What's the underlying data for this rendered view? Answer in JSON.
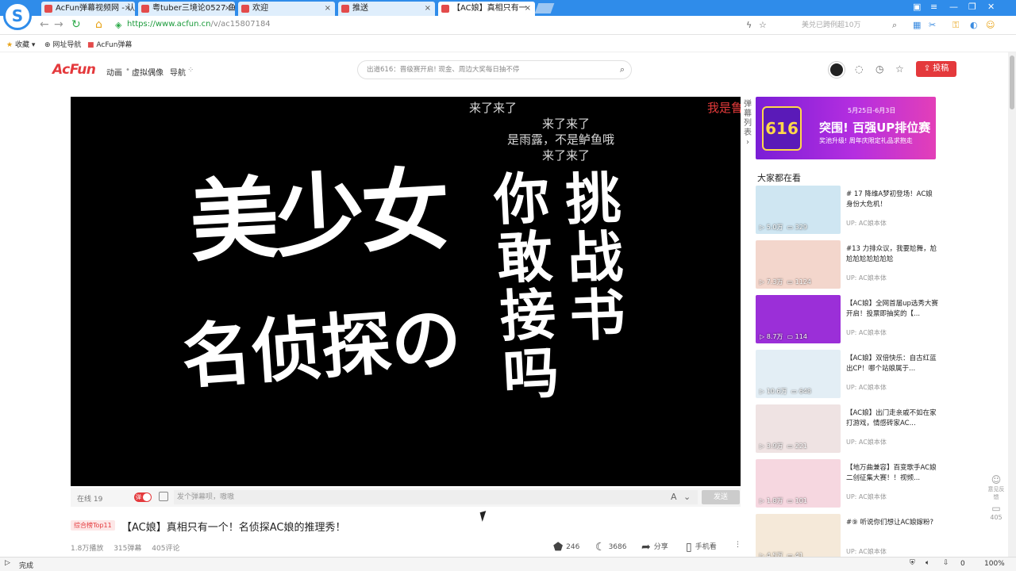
{
  "browser": {
    "tabs": [
      {
        "label": "AcFun弹幕视频网 - 认真你就输啦",
        "left": 0
      },
      {
        "label": "粤tuber三境论0527 鱼",
        "left": 0
      },
      {
        "label": "欢迎",
        "left": 0
      },
      {
        "label": "推送",
        "left": 0
      },
      {
        "label": "【AC娘】真相只有一",
        "left": 0
      }
    ],
    "url_host": "https://www.acfun.cn",
    "url_path": "/v/ac15807184",
    "addr_search_placeholder": "美兑已跨例超10万",
    "bookmarks": [
      "收藏",
      "网址导航",
      "AcFun弹幕"
    ],
    "status_left": "完成",
    "status_right": "0",
    "zoom": "100%"
  },
  "header": {
    "logo": "AcFun",
    "nav": [
      "动画",
      "虚拟偶像",
      "导航"
    ],
    "search_placeholder": "出道616：晋级赛开启! 现金、周边大奖每日抽不停",
    "upload_label": "投稿"
  },
  "player": {
    "danmaku": [
      {
        "text": "来了来了"
      },
      {
        "text": "来了来了"
      },
      {
        "text": "是雨露，不是鲈鱼哦"
      },
      {
        "text": "来了来了"
      },
      {
        "text": "我是鲁"
      }
    ],
    "calligraphy": {
      "title": "美少女",
      "subtitle": "名侦探の",
      "col1": "你敢接吗",
      "col2": "挑战书"
    },
    "danmaku_list_label": "弹幕列表",
    "online_label": "在线",
    "online_count": "19",
    "dm_toggle_label": "弹",
    "dm_input_placeholder": "发个弹幕呗，嗷嗷",
    "send_label": "发送"
  },
  "video": {
    "rank_badge": "综合榜Top11",
    "title": "【AC娘】真相只有一个！名侦探AC娘的推理秀！",
    "plays": "1.8万播放",
    "danmaku_count": "315弹幕",
    "comments": "405评论",
    "likes": "246",
    "bananas": "3686",
    "share_label": "分享",
    "mobile_label": "手机看"
  },
  "sidebar": {
    "banner": {
      "badge": "616",
      "date": "5月25日-6月3日",
      "title": "突围! 百强UP排位赛",
      "subtitle": "奖池升级! 周年庆限定礼品求抱走"
    },
    "heading": "大家都在看",
    "items": [
      {
        "title": "# 17 降维A梦初登场！AC娘身份大危机！",
        "up": "UP: AC娘本体",
        "views": "5.0万",
        "dm": "329",
        "bg": "#cfe6f2"
      },
      {
        "title": "#13 力排众议，我要尬舞，尬尬尬尬尬尬尬尬",
        "up": "UP: AC娘本体",
        "views": "7.3万",
        "dm": "1124",
        "bg": "#f3d6cc"
      },
      {
        "title": "【AC娘】全网首届up选秀大赛开启！投票即抽奖的【...",
        "up": "UP: AC娘本体",
        "views": "8.7万",
        "dm": "114",
        "bg": "#9b2fd8"
      },
      {
        "title": "【AC娘】双倍快乐：自古红蓝出CP！哪个站娘属于...",
        "up": "UP: AC娘本体",
        "views": "10.6万",
        "dm": "648",
        "bg": "#e3eef5"
      },
      {
        "title": "【AC娘】出门走亲戚不如在家打游戏，情感砖家AC...",
        "up": "UP: AC娘本体",
        "views": "3.9万",
        "dm": "221",
        "bg": "#efe3e3"
      },
      {
        "title": "【地万曲兼容】百变歌手AC娘二创征集大赛！！视频...",
        "up": "UP: AC娘本体",
        "views": "1.8万",
        "dm": "101",
        "bg": "#f6d7e0"
      },
      {
        "title": "#⑨ 听说你们想让AC娘嫁粉?",
        "up": "UP: AC娘本体",
        "views": "4.5万",
        "dm": "41",
        "bg": "#f5e9d9"
      }
    ]
  },
  "float": {
    "feedback": "意见反馈",
    "comments": "405"
  }
}
